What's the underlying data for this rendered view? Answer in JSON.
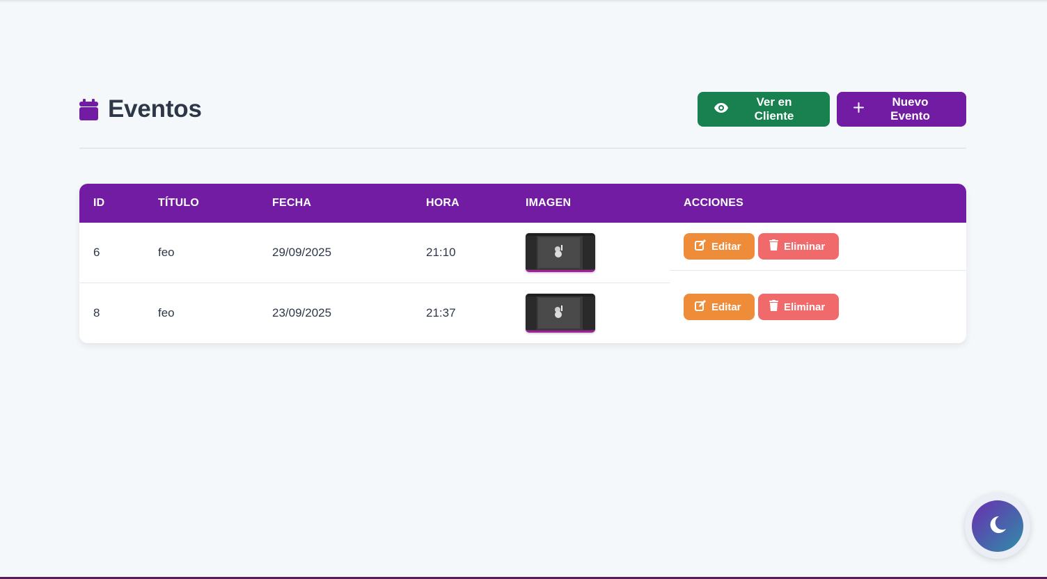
{
  "page": {
    "title": "Eventos",
    "title_icon": "calendar-icon",
    "accent_color": "#711ca3"
  },
  "toolbar": {
    "view_client_label": "Ver en Cliente",
    "view_client_icon": "eye-icon",
    "view_client_color": "#19814f",
    "new_event_label": "Nuevo Evento",
    "new_event_icon": "plus-icon",
    "new_event_color": "#711ca3"
  },
  "table": {
    "columns": [
      "ID",
      "TÍTULO",
      "FECHA",
      "HORA",
      "IMAGEN",
      "ACCIONES"
    ],
    "rows": [
      {
        "id": "6",
        "title": "feo",
        "date": "29/09/2025",
        "time": "21:10",
        "edit_label": "Editar",
        "delete_label": "Eliminar"
      },
      {
        "id": "8",
        "title": "feo",
        "date": "23/09/2025",
        "time": "21:37",
        "edit_label": "Editar",
        "delete_label": "Eliminar"
      }
    ],
    "edit_color": "#ee8c3a",
    "delete_color": "#f06a6c"
  },
  "theme_toggle": {
    "icon": "moon-icon"
  }
}
